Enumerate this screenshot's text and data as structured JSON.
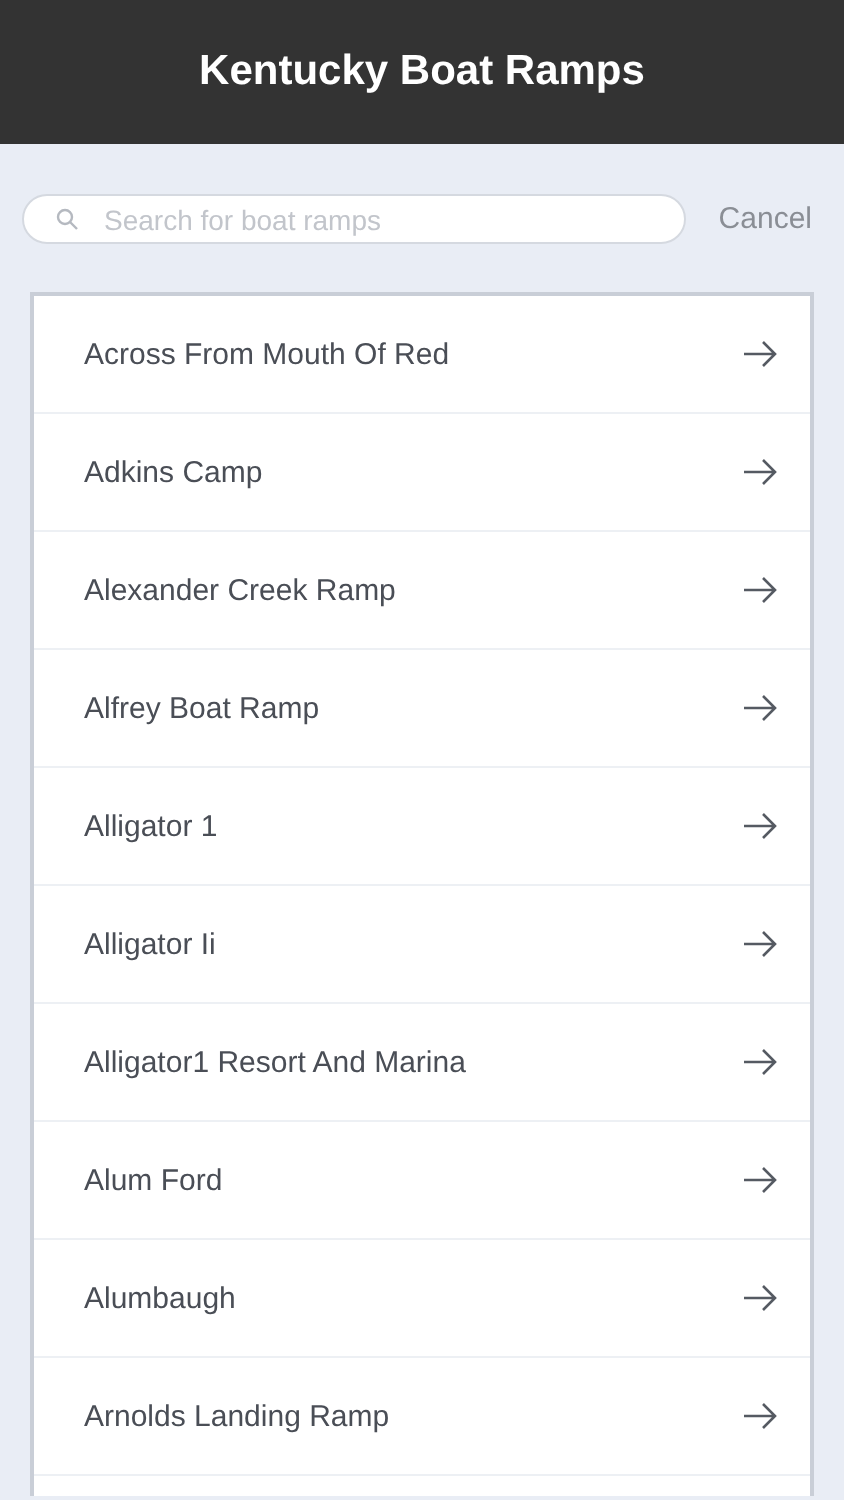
{
  "header": {
    "title": "Kentucky Boat Ramps"
  },
  "search": {
    "placeholder": "Search for boat ramps",
    "cancel": "Cancel"
  },
  "ramps": [
    {
      "name": "Across From Mouth Of Red"
    },
    {
      "name": "Adkins Camp"
    },
    {
      "name": "Alexander Creek Ramp"
    },
    {
      "name": "Alfrey Boat Ramp"
    },
    {
      "name": "Alligator 1"
    },
    {
      "name": "Alligator Ii"
    },
    {
      "name": "Alligator1 Resort And Marina"
    },
    {
      "name": "Alum Ford"
    },
    {
      "name": "Alumbaugh"
    },
    {
      "name": "Arnolds Landing Ramp"
    }
  ]
}
